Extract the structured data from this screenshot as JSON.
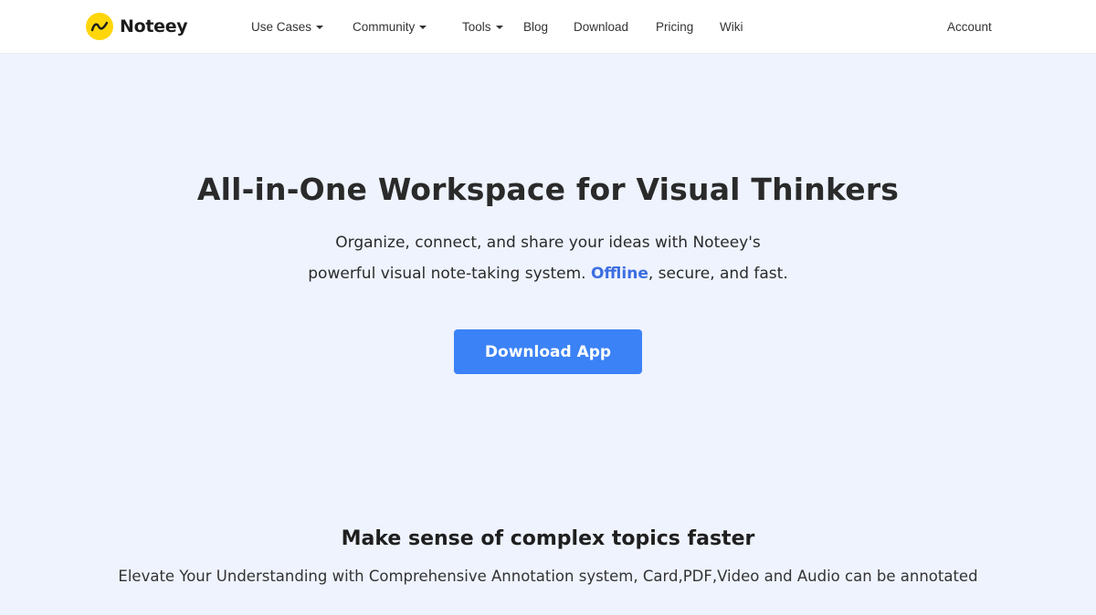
{
  "brand": {
    "name": "Noteey",
    "logo_color": "#ffd60a"
  },
  "nav": {
    "items": [
      {
        "label": "Use Cases",
        "dropdown": true
      },
      {
        "label": "Community",
        "dropdown": true
      },
      {
        "label": "Tools",
        "dropdown": true
      },
      {
        "label": "Blog",
        "dropdown": false
      },
      {
        "label": "Download",
        "dropdown": false
      },
      {
        "label": "Pricing",
        "dropdown": false
      },
      {
        "label": "Wiki",
        "dropdown": false
      }
    ],
    "account_label": "Account"
  },
  "hero": {
    "title": "All-in-One Workspace for Visual Thinkers",
    "line1": "Organize, connect, and share your ideas with Noteey's",
    "line2_prefix": "powerful visual note-taking system. ",
    "line2_highlight": "Offline",
    "line2_suffix": ", secure, and fast.",
    "cta_label": "Download App",
    "accent_color": "#3b82f6"
  },
  "section": {
    "title": "Make sense of complex topics faster",
    "subtitle": "Elevate Your Understanding with Comprehensive Annotation system, Card,PDF,Video and Audio can be annotated"
  },
  "colors": {
    "page_bg": "#eef3fe",
    "nav_bg": "#ffffff",
    "highlight": "#3d6fe0"
  }
}
